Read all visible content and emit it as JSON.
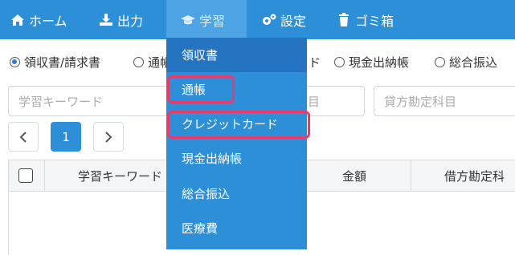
{
  "navbar": {
    "home": "ホーム",
    "output": "出力",
    "learning": "学習",
    "settings": "設定",
    "trash": "ゴミ箱"
  },
  "radio_options": [
    "領収書/請求書",
    "通帳",
    "クレジットカード",
    "現金出納帳",
    "総合振込"
  ],
  "radio_selected": "領収書/請求書",
  "radio_visible": {
    "r0": "領収書/請求書",
    "r1": "通帳",
    "r2": "ド",
    "r3": "現金出納帳",
    "r4": "総合振込"
  },
  "filters": {
    "keyword_placeholder": "学習キーワード",
    "middle_placeholder_visible": "目",
    "credit_account_placeholder": "貸方勘定科目"
  },
  "pagination": {
    "current_page": "1"
  },
  "table": {
    "columns": [
      "学習キーワード",
      "金額",
      "借方勘定科"
    ]
  },
  "dropdown": {
    "items": [
      "領収書",
      "通帳",
      "クレジットカード",
      "現金出納帳",
      "総合振込",
      "医療費"
    ],
    "highlighted": [
      "通帳",
      "クレジットカード"
    ]
  },
  "colors": {
    "navbar": "#2d8fd8",
    "dropdown": "#2d8fd8",
    "dropdown_first_item": "#2474c2",
    "highlight_border": "#e83a6c",
    "page_active": "#2d8fd8"
  }
}
